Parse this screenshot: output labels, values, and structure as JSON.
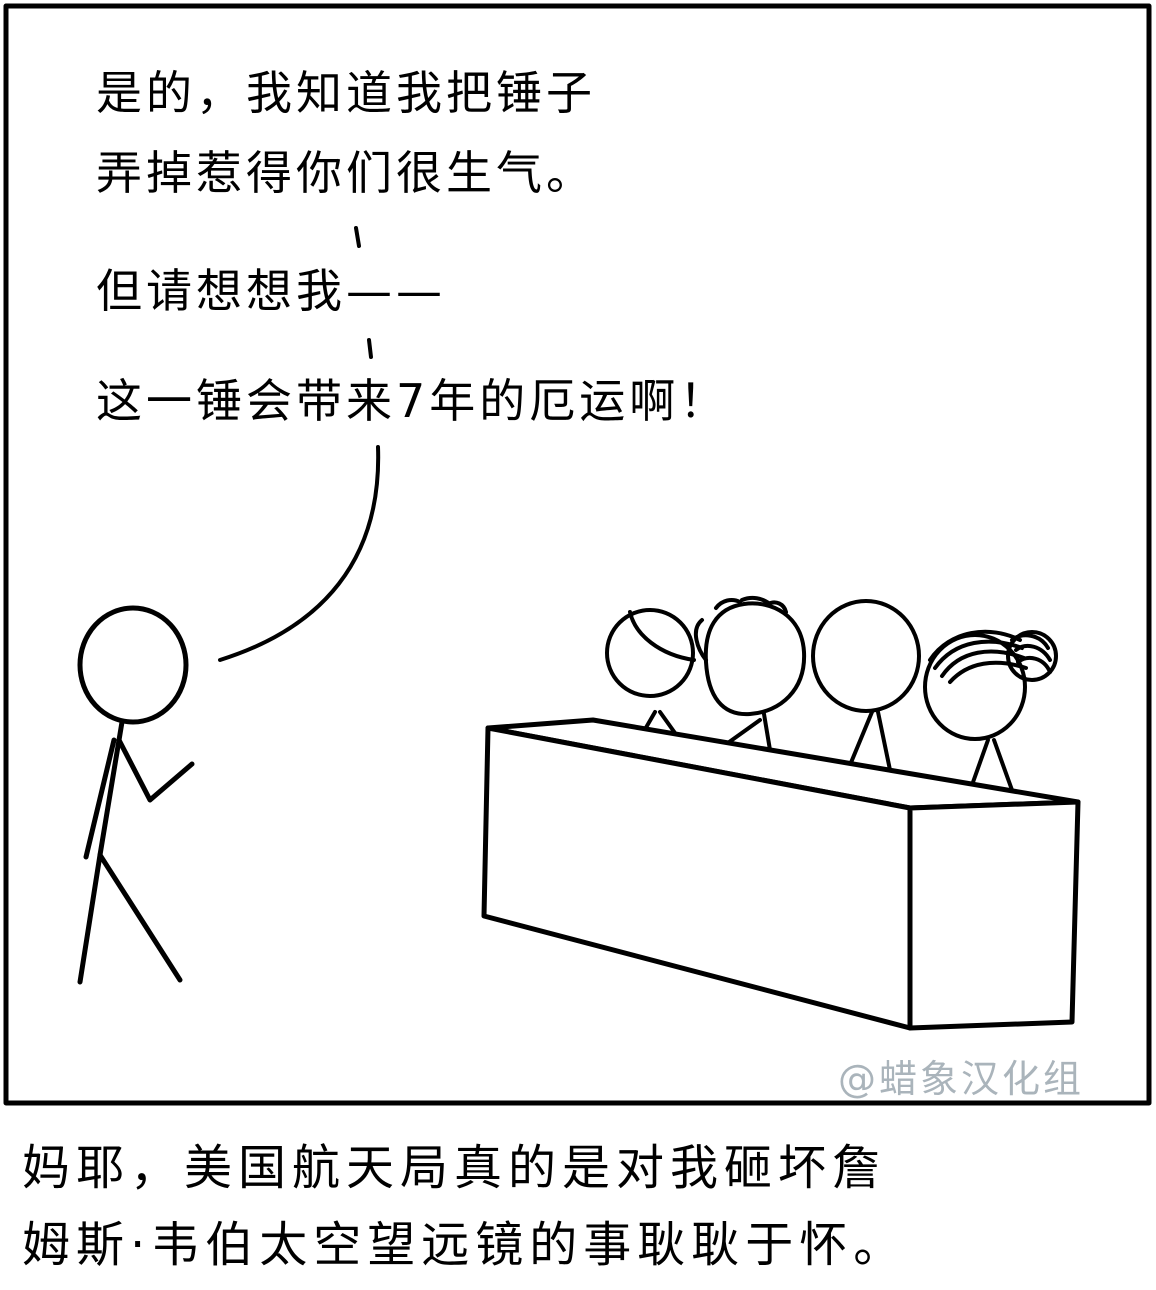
{
  "panel": {
    "speech_lines": [
      "是的，我知道我把锤子",
      "弄掉惹得你们很生气。",
      "但请想想我——",
      "这一锤会带来7年的厄运啊！"
    ],
    "watermark": "@蜡象汉化组"
  },
  "caption": {
    "lines": [
      "妈耶，美国航天局真的是对我砸坏詹",
      "姆斯·韦伯太空望远镜的事耿耿于怀。"
    ]
  }
}
